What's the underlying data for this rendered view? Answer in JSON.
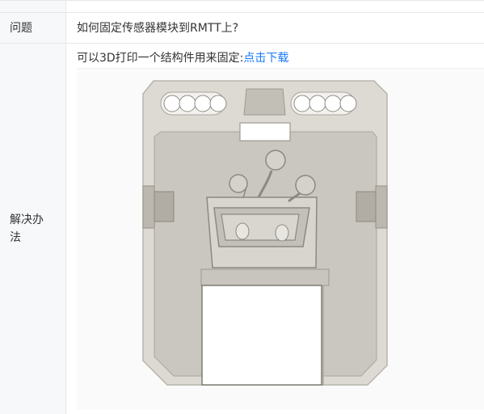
{
  "table": {
    "rows": [
      {
        "label": "问题",
        "value": "如何固定传感器模块到RMTT上?"
      },
      {
        "label": "解决办法",
        "text": "可以3D打印一个结构件用来固定:",
        "link_text": "点击下载"
      }
    ]
  },
  "colors": {
    "label_bg": "#f7f8fa",
    "border": "#e7e7e7",
    "link": "#1677ff",
    "text": "#333333"
  }
}
